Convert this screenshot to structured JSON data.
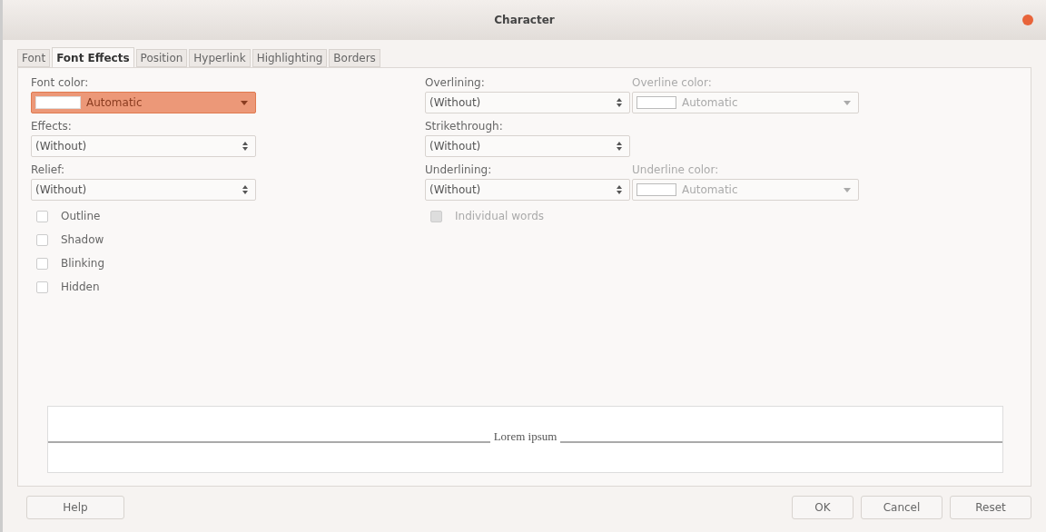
{
  "window": {
    "title": "Character"
  },
  "tabs": [
    {
      "label": "Font",
      "selected": false
    },
    {
      "label": "Font Effects",
      "selected": true
    },
    {
      "label": "Position",
      "selected": false
    },
    {
      "label": "Hyperlink",
      "selected": false
    },
    {
      "label": "Highlighting",
      "selected": false
    },
    {
      "label": "Borders",
      "selected": false
    }
  ],
  "left_fields": [
    {
      "label": "Font color:",
      "kind": "color",
      "value": "Automatic",
      "focused": true,
      "disabled": false
    },
    {
      "label": "Effects:",
      "kind": "listbox",
      "value": "(Without)",
      "focused": false,
      "disabled": false
    },
    {
      "label": "Relief:",
      "kind": "listbox",
      "value": "(Without)",
      "focused": false,
      "disabled": false
    }
  ],
  "checkboxes": [
    {
      "label": "Outline",
      "checked": false,
      "disabled": false
    },
    {
      "label": "Shadow",
      "checked": false,
      "disabled": false
    },
    {
      "label": "Blinking",
      "checked": false,
      "disabled": false
    },
    {
      "label": "Hidden",
      "checked": false,
      "disabled": false
    }
  ],
  "right_rows": [
    {
      "main": {
        "label": "Overlining:",
        "kind": "listbox",
        "value": "(Without)",
        "focused": false,
        "disabled": false
      },
      "color": {
        "label": "Overline color:",
        "kind": "color",
        "value": "Automatic",
        "focused": false,
        "disabled": true
      }
    },
    {
      "main": {
        "label": "Strikethrough:",
        "kind": "listbox",
        "value": "(Without)",
        "focused": false,
        "disabled": false
      }
    },
    {
      "main": {
        "label": "Underlining:",
        "kind": "listbox",
        "value": "(Without)",
        "focused": false,
        "disabled": false
      },
      "color": {
        "label": "Underline color:",
        "kind": "color",
        "value": "Automatic",
        "focused": false,
        "disabled": true
      }
    }
  ],
  "individual_words": {
    "label": "Individual words",
    "checked": false,
    "disabled": true
  },
  "preview": {
    "text": "Lorem ipsum"
  },
  "buttons": {
    "left": [
      "Help"
    ],
    "right": [
      "OK",
      "Cancel",
      "Reset"
    ]
  }
}
